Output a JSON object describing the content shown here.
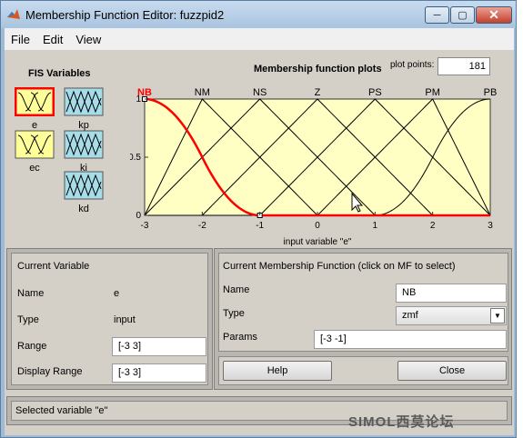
{
  "window": {
    "title": "Membership Function Editor: fuzzpid2",
    "controls": {
      "minimize": "─",
      "maximize": "▢",
      "close": "✕"
    }
  },
  "menu": [
    "File",
    "Edit",
    "View"
  ],
  "fis_variables": {
    "title": "FIS Variables",
    "inputs": [
      {
        "name": "e",
        "selected": true
      },
      {
        "name": "ec",
        "selected": false
      }
    ],
    "outputs": [
      {
        "name": "kp"
      },
      {
        "name": "ki"
      },
      {
        "name": "kd"
      }
    ],
    "colors": {
      "input": "#ffff99",
      "output": "#a6dde8",
      "selected_border": "#ff0000"
    }
  },
  "plot": {
    "title": "Membership function plots",
    "plot_points_label": "plot points:",
    "plot_points_value": "181",
    "xlabel": "input variable \"e\"",
    "x_ticks": [
      "-3",
      "-2",
      "-1",
      "0",
      "1",
      "2",
      "3"
    ],
    "y_ticks": [
      "0",
      "0.5",
      "1"
    ],
    "mf_labels": [
      "NB",
      "NM",
      "NS",
      "Z",
      "PS",
      "PM",
      "PB"
    ],
    "selected_mf": "NB",
    "background_color": "#ffffc4",
    "selected_color": "#ff0000"
  },
  "chart_data": {
    "type": "line",
    "title": "Membership function plots",
    "xlabel": "input variable \"e\"",
    "ylabel": "",
    "xlim": [
      -3,
      3
    ],
    "ylim": [
      0,
      1
    ],
    "series": [
      {
        "name": "NB",
        "shape": "zmf",
        "params": [
          -3,
          -1
        ]
      },
      {
        "name": "NM",
        "shape": "trimf",
        "params": [
          -3,
          -2,
          0
        ]
      },
      {
        "name": "NS",
        "shape": "trimf",
        "params": [
          -3,
          -1,
          1
        ]
      },
      {
        "name": "Z",
        "shape": "trimf",
        "params": [
          -2,
          0,
          2
        ]
      },
      {
        "name": "PS",
        "shape": "trimf",
        "params": [
          -1,
          1,
          3
        ]
      },
      {
        "name": "PM",
        "shape": "trimf",
        "params": [
          0,
          2,
          3
        ]
      },
      {
        "name": "PB",
        "shape": "smf",
        "params": [
          1,
          3
        ]
      }
    ]
  },
  "current_variable": {
    "header": "Current Variable",
    "name_label": "Name",
    "name_value": "e",
    "type_label": "Type",
    "type_value": "input",
    "range_label": "Range",
    "range_value": "[-3 3]",
    "display_range_label": "Display Range",
    "display_range_value": "[-3 3]"
  },
  "current_mf": {
    "header": "Current Membership Function (click on MF to select)",
    "name_label": "Name",
    "name_value": "NB",
    "type_label": "Type",
    "type_value": "zmf",
    "params_label": "Params",
    "params_value": "[-3 -1]"
  },
  "buttons": {
    "help": "Help",
    "close": "Close"
  },
  "status": {
    "text": "Selected variable \"e\""
  },
  "watermark": "SIMOL西莫论坛"
}
